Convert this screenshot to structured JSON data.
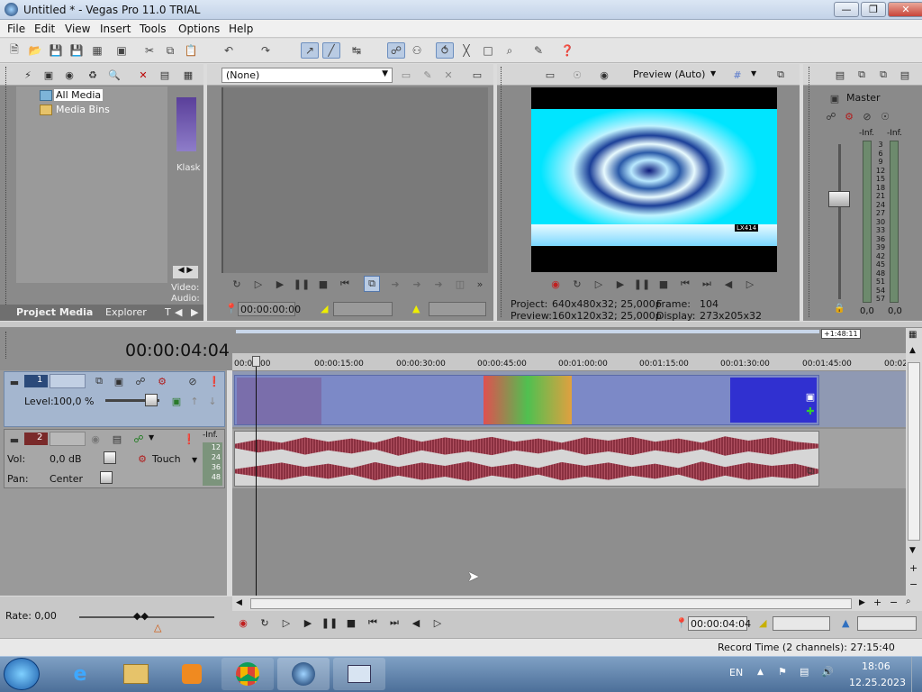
{
  "window": {
    "title": "Untitled * - Vegas Pro 11.0 TRIAL"
  },
  "menu": [
    "File",
    "Edit",
    "View",
    "Insert",
    "Tools",
    "Options",
    "Help"
  ],
  "media_panel": {
    "tree": [
      "All Media",
      "Media Bins"
    ],
    "thumb_caption": "Klask",
    "meta": [
      "Video:",
      "Audio:"
    ],
    "tabs": [
      "Project Media",
      "Explorer",
      "T"
    ]
  },
  "trimmer": {
    "dropdown": "(None)",
    "timecode": "00:00:00:00"
  },
  "preview": {
    "mode": "Preview (Auto)",
    "stats": {
      "project_label": "Project:",
      "project": "640x480x32; 25,000p",
      "frame_label": "Frame:",
      "frame": "104",
      "preview_label": "Preview:",
      "preview": "160x120x32; 25,000p",
      "display_label": "Display:",
      "display": "273x205x32"
    },
    "overlay_text": "LX414"
  },
  "mixer": {
    "master": "Master",
    "inf_l": "-Inf.",
    "inf_r": "-Inf.",
    "scale": [
      "3",
      "6",
      "9",
      "12",
      "15",
      "18",
      "21",
      "24",
      "27",
      "30",
      "33",
      "36",
      "39",
      "42",
      "45",
      "48",
      "51",
      "54",
      "57"
    ],
    "val_l": "0,0",
    "val_r": "0,0"
  },
  "timeline": {
    "cursor_time": "00:00:04:04",
    "region_end": "+1:48:11",
    "ruler": [
      "00:00:00",
      "00:00:15:00",
      "00:00:30:00",
      "00:00:45:00",
      "00:01:00:00",
      "00:01:15:00",
      "00:01:30:00",
      "00:01:45:00",
      "00:02"
    ]
  },
  "tracks": {
    "video": {
      "number": "1",
      "level_label": "Level:",
      "level": "100,0 %"
    },
    "audio": {
      "number": "2",
      "inf": "-Inf.",
      "meter": [
        "12",
        "24",
        "36",
        "48"
      ],
      "vol_label": "Vol:",
      "vol": "0,0 dB",
      "pan_label": "Pan:",
      "pan": "Center",
      "touch": "Touch"
    }
  },
  "transport": {
    "rate": "Rate: 0,00",
    "timecode": "00:00:04:04",
    "record_time": "Record Time (2 channels): 27:15:40"
  },
  "taskbar": {
    "lang": "EN",
    "time": "18:06",
    "date": "12.25.2023"
  },
  "colors": {
    "accent": "#b9cbe3",
    "video_track": "#7e8fc4",
    "audio_wave": "#8a3040",
    "preview_bg": "#00e5ff"
  }
}
